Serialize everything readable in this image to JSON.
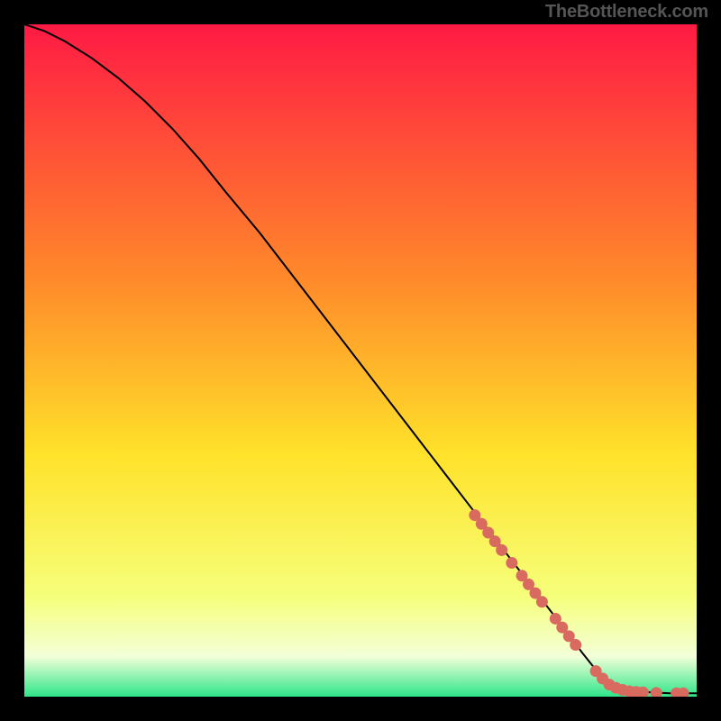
{
  "attribution": "TheBottleneck.com",
  "colors": {
    "bg": "#000000",
    "gradient_top": "#ff1a44",
    "gradient_mid1": "#ff8a2a",
    "gradient_mid2": "#ffe22a",
    "gradient_mid3": "#f6ff7a",
    "gradient_bottom_whitish": "#f3ffd8",
    "gradient_green": "#2ee68a",
    "curve": "#000000",
    "marker": "#d96a60"
  },
  "chart_data": {
    "type": "line",
    "title": "",
    "xlabel": "",
    "ylabel": "",
    "xlim": [
      0,
      100
    ],
    "ylim": [
      0,
      100
    ],
    "series": [
      {
        "name": "curve",
        "x": [
          0,
          3,
          6,
          10,
          14,
          18,
          22,
          26,
          30,
          35,
          40,
          45,
          50,
          55,
          60,
          65,
          70,
          75,
          80,
          83,
          85,
          88,
          92,
          96,
          100
        ],
        "y": [
          100,
          99,
          97.5,
          95,
          92,
          88.5,
          84.5,
          80,
          75,
          69,
          62.5,
          56,
          49.5,
          43,
          36.5,
          30,
          23.5,
          17,
          10.5,
          6.5,
          4,
          1.5,
          0.7,
          0.5,
          0.5
        ]
      }
    ],
    "markers": {
      "name": "highlighted-segment",
      "points": [
        {
          "x": 67,
          "y": 27
        },
        {
          "x": 68,
          "y": 25.7
        },
        {
          "x": 69,
          "y": 24.4
        },
        {
          "x": 70,
          "y": 23.1
        },
        {
          "x": 71,
          "y": 21.8
        },
        {
          "x": 72.5,
          "y": 19.9
        },
        {
          "x": 74,
          "y": 18
        },
        {
          "x": 75,
          "y": 16.7
        },
        {
          "x": 76,
          "y": 15.4
        },
        {
          "x": 77,
          "y": 14.1
        },
        {
          "x": 79,
          "y": 11.6
        },
        {
          "x": 80,
          "y": 10.3
        },
        {
          "x": 81,
          "y": 9
        },
        {
          "x": 82,
          "y": 7.7
        },
        {
          "x": 85,
          "y": 3.8
        },
        {
          "x": 86,
          "y": 2.7
        },
        {
          "x": 87,
          "y": 1.8
        },
        {
          "x": 88,
          "y": 1.3
        },
        {
          "x": 89,
          "y": 1.0
        },
        {
          "x": 90,
          "y": 0.8
        },
        {
          "x": 91,
          "y": 0.7
        },
        {
          "x": 92,
          "y": 0.65
        },
        {
          "x": 94,
          "y": 0.55
        },
        {
          "x": 97,
          "y": 0.5
        },
        {
          "x": 98,
          "y": 0.5
        }
      ]
    }
  }
}
